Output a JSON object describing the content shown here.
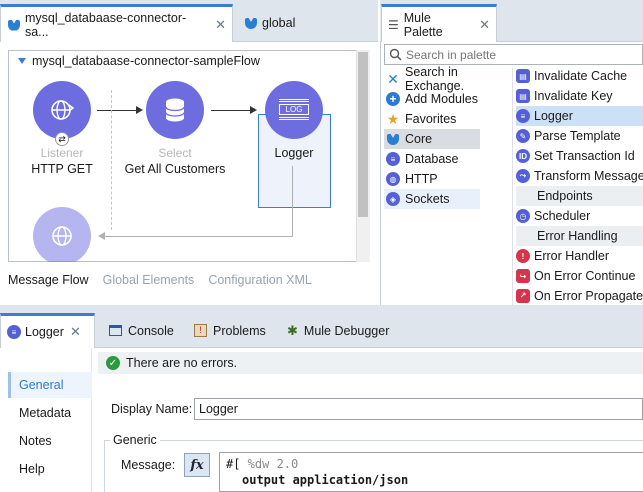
{
  "editor": {
    "tabs": [
      {
        "label": "mysql_databaase-connector-sa..."
      },
      {
        "label": "global"
      }
    ],
    "flow_title": "mysql_databaase-connector-sampleFlow",
    "nodes": [
      {
        "sub": "Listener",
        "name": "HTTP GET"
      },
      {
        "sub": "Select",
        "name": "Get All Customers"
      },
      {
        "sub": "",
        "name": "Logger",
        "icon_text": "LOG"
      }
    ],
    "bottom_tabs": [
      "Message Flow",
      "Global Elements",
      "Configuration XML"
    ]
  },
  "palette": {
    "tab_label": "Mule Palette",
    "search_placeholder": "Search in palette",
    "left_items": [
      {
        "label": "Search in Exchange.",
        "icon": "exchange-icon"
      },
      {
        "label": "Add Modules",
        "icon": "plus-icon"
      },
      {
        "label": "Favorites",
        "icon": "star-icon"
      },
      {
        "label": "Core",
        "icon": "mule-icon"
      },
      {
        "label": "Database",
        "icon": "database-icon"
      },
      {
        "label": "HTTP",
        "icon": "globe-icon"
      },
      {
        "label": "Sockets",
        "icon": "sockets-icon"
      }
    ],
    "right_items": [
      {
        "label": "Invalidate Cache",
        "kind": "item"
      },
      {
        "label": "Invalidate Key",
        "kind": "item"
      },
      {
        "label": "Logger",
        "kind": "item"
      },
      {
        "label": "Parse Template",
        "kind": "item"
      },
      {
        "label": "Set Transaction Id",
        "kind": "item"
      },
      {
        "label": "Transform Message",
        "kind": "item"
      },
      {
        "label": "Endpoints",
        "kind": "group"
      },
      {
        "label": "Scheduler",
        "kind": "item"
      },
      {
        "label": "Error Handling",
        "kind": "group"
      },
      {
        "label": "Error Handler",
        "kind": "item"
      },
      {
        "label": "On Error Continue",
        "kind": "item"
      },
      {
        "label": "On Error Propagate",
        "kind": "item"
      }
    ]
  },
  "properties": {
    "tabs": [
      {
        "label": "Logger"
      },
      {
        "label": "Console"
      },
      {
        "label": "Problems"
      },
      {
        "label": "Mule Debugger"
      }
    ],
    "nav": [
      "General",
      "Metadata",
      "Notes",
      "Help"
    ],
    "status": "There are no errors.",
    "display_name_label": "Display Name:",
    "display_name_value": "Logger",
    "generic_label": "Generic",
    "message_label": "Message:",
    "fx_label": "fx",
    "code": {
      "prefix": "#[",
      "line1": " %dw 2.0",
      "line2": "output application/json"
    }
  }
}
